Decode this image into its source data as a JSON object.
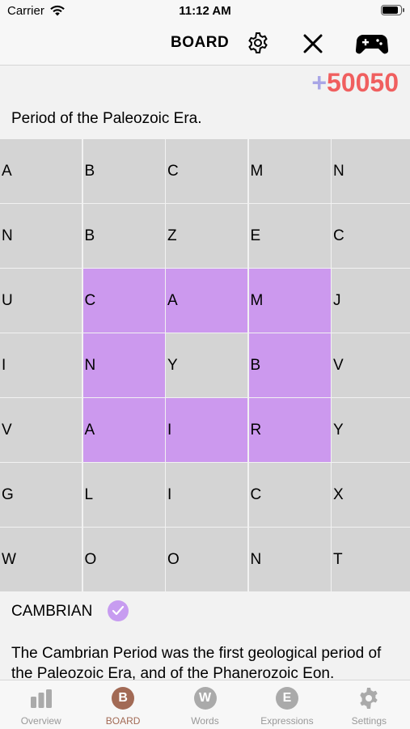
{
  "status": {
    "carrier": "Carrier",
    "time": "11:12 AM"
  },
  "nav": {
    "title": "BOARD"
  },
  "score": {
    "plus": "+",
    "value": "50050"
  },
  "question": "Period of the Paleozoic Era.",
  "grid": {
    "rows": [
      [
        "A",
        "B",
        "C",
        "M",
        "N"
      ],
      [
        "N",
        "B",
        "Z",
        "E",
        "C"
      ],
      [
        "U",
        "C",
        "A",
        "M",
        "J"
      ],
      [
        "I",
        "N",
        "Y",
        "B",
        "V"
      ],
      [
        "V",
        "A",
        "I",
        "R",
        "Y"
      ],
      [
        "G",
        "L",
        "I",
        "C",
        "X"
      ],
      [
        "W",
        "O",
        "O",
        "N",
        "T"
      ]
    ],
    "selected": [
      [
        2,
        1
      ],
      [
        2,
        2
      ],
      [
        2,
        3
      ],
      [
        3,
        1
      ],
      [
        3,
        3
      ],
      [
        4,
        1
      ],
      [
        4,
        2
      ],
      [
        4,
        3
      ]
    ],
    "selected_color": "#cc99ee"
  },
  "answer": {
    "word": "CAMBRIAN",
    "accent": "#c79cf0"
  },
  "description": "The Cambrian Period was the first geological period of the Paleozoic Era, and of the Phanerozoic Eon.",
  "tabs": [
    {
      "label": "Overview",
      "icon": "bar-chart-icon"
    },
    {
      "label": "BOARD",
      "letter": "B",
      "icon": "letter-b-icon",
      "active": true,
      "color": "#a26a55"
    },
    {
      "label": "Words",
      "letter": "W",
      "icon": "letter-w-icon",
      "color": "#aaaaaa"
    },
    {
      "label": "Expressions",
      "letter": "E",
      "icon": "letter-e-icon",
      "color": "#aaaaaa"
    },
    {
      "label": "Settings",
      "icon": "gear-icon"
    }
  ]
}
